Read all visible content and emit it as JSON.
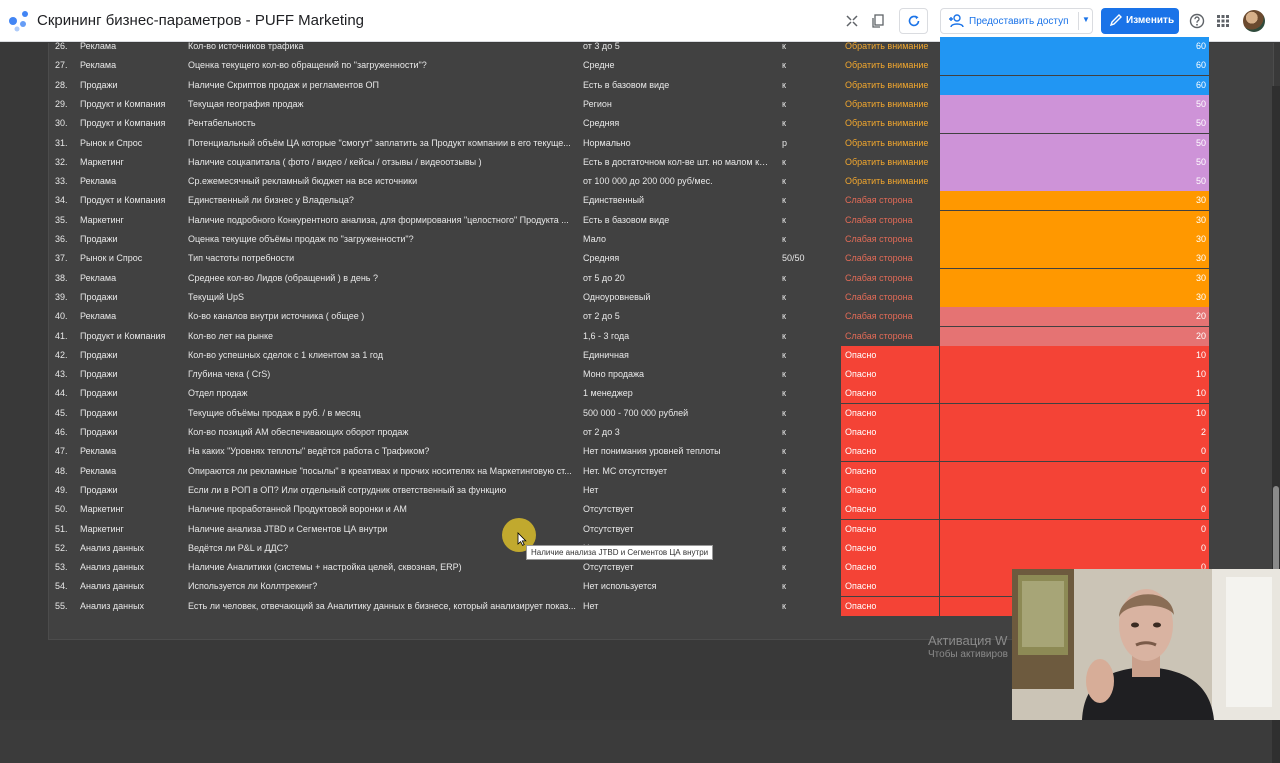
{
  "header": {
    "title": "Скрининг бизнес-параметров - PUFF Marketing",
    "share_label": "Предоставить доступ",
    "edit_label": "Изменить"
  },
  "colors": {
    "blue": "#2196f3",
    "violet": "#ce93d8",
    "orange": "#ff9800",
    "pink": "#e57373",
    "red": "#f44336",
    "status_attention": "#f2a72e",
    "status_weak": "#e36b57",
    "status_danger": "#ffffff"
  },
  "rows": [
    {
      "n": "26.",
      "cat": "Реклама",
      "param": "Кол-во источников трафика",
      "val": "от 3 до 5",
      "code": "к",
      "status": "Обратить внимание",
      "score": "60",
      "bar": "blue"
    },
    {
      "n": "27.",
      "cat": "Реклама",
      "param": "Оценка текущего кол-во обращений по \"загруженности\"?",
      "val": "Средне",
      "code": "к",
      "status": "Обратить внимание",
      "score": "60",
      "bar": "blue"
    },
    {
      "n": "28.",
      "cat": "Продажи",
      "param": "Наличие Скриптов продаж и регламентов ОП",
      "val": "Есть в базовом виде",
      "code": "к",
      "status": "Обратить внимание",
      "score": "60",
      "bar": "blue"
    },
    {
      "n": "29.",
      "cat": "Продукт и Компания",
      "param": "Текущая география продаж",
      "val": "Регион",
      "code": "к",
      "status": "Обратить внимание",
      "score": "50",
      "bar": "violet"
    },
    {
      "n": "30.",
      "cat": "Продукт и Компания",
      "param": "Рентабельность",
      "val": "Средняя",
      "code": "к",
      "status": "Обратить внимание",
      "score": "50",
      "bar": "violet"
    },
    {
      "n": "31.",
      "cat": "Рынок и Спрос",
      "param": "Потенциальный объём ЦА которые \"смогут\" заплатить за Продукт компании в его текуще...",
      "val": "Нормально",
      "code": "р",
      "status": "Обратить внимание",
      "score": "50",
      "bar": "violet"
    },
    {
      "n": "32.",
      "cat": "Маркетинг",
      "param": "Наличие соцкапитала ( фото / видео / кейсы / отзывы / видеоотзывы )",
      "val": "Есть в достаточном кол-ве шт. но малом ко...",
      "code": "к",
      "status": "Обратить внимание",
      "score": "50",
      "bar": "violet"
    },
    {
      "n": "33.",
      "cat": "Реклама",
      "param": "Ср.ежемесячный рекламный бюджет на все источники",
      "val": "от 100 000 до 200 000 руб/мес.",
      "code": "к",
      "status": "Обратить внимание",
      "score": "50",
      "bar": "violet"
    },
    {
      "n": "34.",
      "cat": "Продукт и Компания",
      "param": "Единственный ли бизнес у Владельца?",
      "val": "Единственный",
      "code": "к",
      "status": "Слабая сторона",
      "score": "30",
      "bar": "orange"
    },
    {
      "n": "35.",
      "cat": "Маркетинг",
      "param": "Наличие подробного Конкурентного анализа, для формирования \"целостного\" Продукта ...",
      "val": "Есть в базовом виде",
      "code": "к",
      "status": "Слабая сторона",
      "score": "30",
      "bar": "orange"
    },
    {
      "n": "36.",
      "cat": "Продажи",
      "param": "Оценка текущие объёмы продаж по \"загруженности\"?",
      "val": "Мало",
      "code": "к",
      "status": "Слабая сторона",
      "score": "30",
      "bar": "orange"
    },
    {
      "n": "37.",
      "cat": "Рынок и Спрос",
      "param": "Тип частоты потребности",
      "val": "Средняя",
      "code": "50/50",
      "status": "Слабая сторона",
      "score": "30",
      "bar": "orange"
    },
    {
      "n": "38.",
      "cat": "Реклама",
      "param": "Среднее кол-во Лидов (обращений ) в день ?",
      "val": "от 5 до 20",
      "code": "к",
      "status": "Слабая сторона",
      "score": "30",
      "bar": "orange"
    },
    {
      "n": "39.",
      "cat": "Продажи",
      "param": "Текущий UpS",
      "val": "Одноуровневый",
      "code": "к",
      "status": "Слабая сторона",
      "score": "30",
      "bar": "orange"
    },
    {
      "n": "40.",
      "cat": "Реклама",
      "param": "Ко-во каналов внутри источника ( общее )",
      "val": "от 2 до 5",
      "code": "к",
      "status": "Слабая сторона",
      "score": "20",
      "bar": "pink"
    },
    {
      "n": "41.",
      "cat": "Продукт и Компания",
      "param": "Кол-во лет на рынке",
      "val": "1,6 - 3 года",
      "code": "к",
      "status": "Слабая сторона",
      "score": "20",
      "bar": "pink"
    },
    {
      "n": "42.",
      "cat": "Продажи",
      "param": "Кол-во успешных сделок с 1 клиентом за 1 год",
      "val": "Единичная",
      "code": "к",
      "status": "Опасно",
      "score": "10",
      "bar": "red"
    },
    {
      "n": "43.",
      "cat": "Продажи",
      "param": "Глубина чека ( CrS)",
      "val": "Моно продажа",
      "code": "к",
      "status": "Опасно",
      "score": "10",
      "bar": "red"
    },
    {
      "n": "44.",
      "cat": "Продажи",
      "param": "Отдел продаж",
      "val": "1 менеджер",
      "code": "к",
      "status": "Опасно",
      "score": "10",
      "bar": "red"
    },
    {
      "n": "45.",
      "cat": "Продажи",
      "param": "Текущие объёмы продаж в руб. / в месяц",
      "val": "500 000 - 700 000 рублей",
      "code": "к",
      "status": "Опасно",
      "score": "10",
      "bar": "red"
    },
    {
      "n": "46.",
      "cat": "Продажи",
      "param": "Кол-во позиций АМ обеспечивающих оборот продаж",
      "val": "от 2 до 3",
      "code": "к",
      "status": "Опасно",
      "score": "2",
      "bar": "red"
    },
    {
      "n": "47.",
      "cat": "Реклама",
      "param": "На каких \"Уровнях теплоты\" ведётся работа с Трафиком?",
      "val": "Нет понимания уровней теплоты",
      "code": "к",
      "status": "Опасно",
      "score": "0",
      "bar": "red"
    },
    {
      "n": "48.",
      "cat": "Реклама",
      "param": "Опираются ли рекламные \"посылы\" в креативах и прочих носителях на Маркетинговую ст...",
      "val": "Нет. МС отсутствует",
      "code": "к",
      "status": "Опасно",
      "score": "0",
      "bar": "red"
    },
    {
      "n": "49.",
      "cat": "Продажи",
      "param": "Если ли в РОП в ОП? Или отдельный сотрудник ответственный за функцию",
      "val": "Нет",
      "code": "к",
      "status": "Опасно",
      "score": "0",
      "bar": "red"
    },
    {
      "n": "50.",
      "cat": "Маркетинг",
      "param": "Наличие проработанной Продуктовой воронки и АМ",
      "val": "Отсутствует",
      "code": "к",
      "status": "Опасно",
      "score": "0",
      "bar": "red"
    },
    {
      "n": "51.",
      "cat": "Маркетинг",
      "param": "Наличие анализа JTBD и Сегментов ЦА внутри",
      "val": "Отсутствует",
      "code": "к",
      "status": "Опасно",
      "score": "0",
      "bar": "red"
    },
    {
      "n": "52.",
      "cat": "Анализ данных",
      "param": "Ведётся ли P&L и ДДС?",
      "val": "Н",
      "code": "к",
      "status": "Опасно",
      "score": "0",
      "bar": "red"
    },
    {
      "n": "53.",
      "cat": "Анализ данных",
      "param": "Наличие Аналитики (системы + настройка целей, сквозная, ERP)",
      "val": "Отсутствует",
      "code": "к",
      "status": "Опасно",
      "score": "0",
      "bar": "red"
    },
    {
      "n": "54.",
      "cat": "Анализ данных",
      "param": "Используется ли Коллтрекинг?",
      "val": "Нет используется",
      "code": "к",
      "status": "Опасно",
      "score": "",
      "bar": "red"
    },
    {
      "n": "55.",
      "cat": "Анализ данных",
      "param": "Есть ли человек, отвечающий за Аналитику данных в бизнесе, который анализирует показ...",
      "val": "Нет",
      "code": "к",
      "status": "Опасно",
      "score": "",
      "bar": "red"
    }
  ],
  "tooltip": "Наличие анализа JTBD и Сегментов ЦА внутри",
  "watermark": {
    "line1": "Активация W",
    "line2": "Чтобы активиров"
  }
}
